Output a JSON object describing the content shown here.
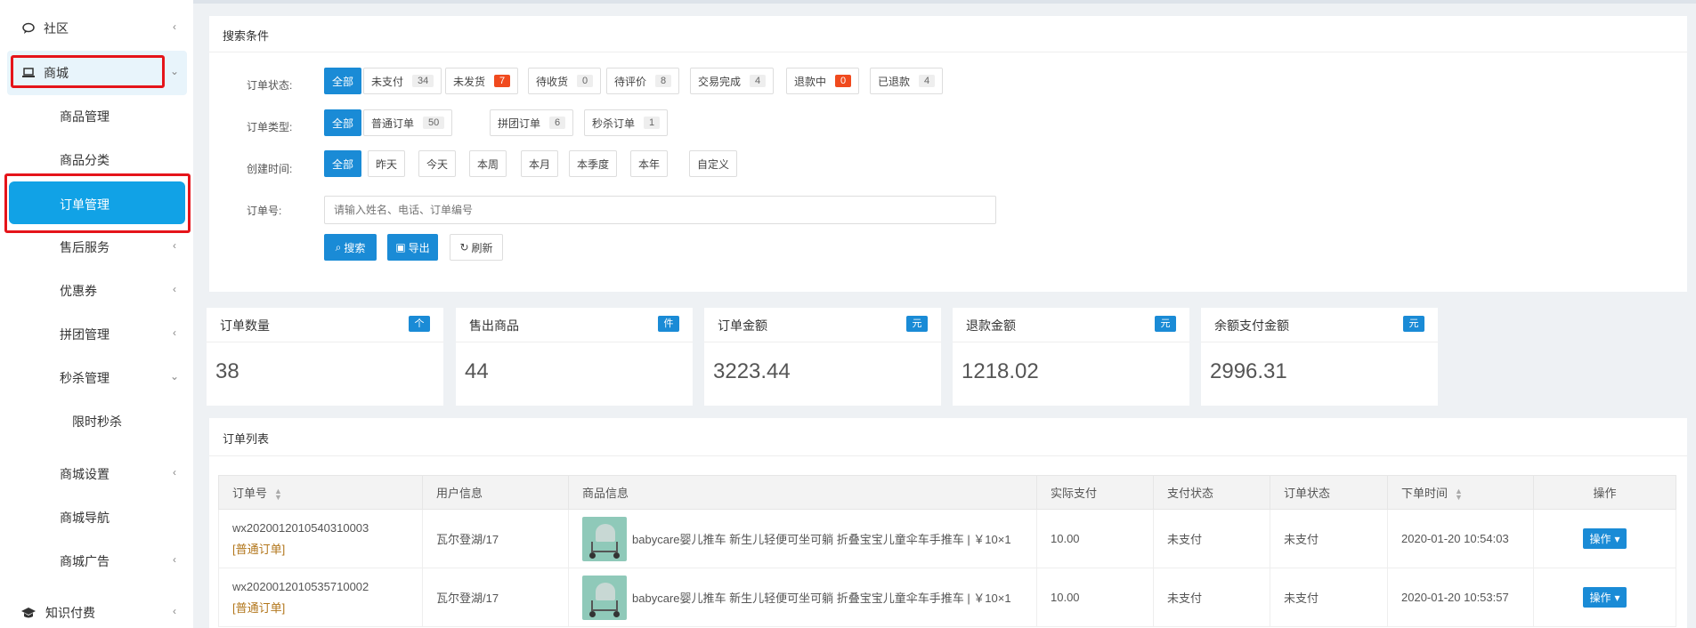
{
  "sidebar": {
    "items": [
      {
        "label": "社区",
        "icon": "chat-icon"
      },
      {
        "label": "商城",
        "icon": "laptop-icon"
      },
      {
        "label": "商品管理"
      },
      {
        "label": "商品分类"
      },
      {
        "label": "订单管理"
      },
      {
        "label": "售后服务"
      },
      {
        "label": "优惠券"
      },
      {
        "label": "拼团管理"
      },
      {
        "label": "秒杀管理"
      },
      {
        "label": "限时秒杀"
      },
      {
        "label": "商城设置"
      },
      {
        "label": "商城导航"
      },
      {
        "label": "商城广告"
      },
      {
        "label": "知识付费",
        "icon": "graduation-cap-icon"
      }
    ]
  },
  "search": {
    "title": "搜索条件",
    "status_label": "订单状态:",
    "type_label": "订单类型:",
    "time_label": "创建时间:",
    "order_no_label": "订单号:",
    "placeholder": "请输入姓名、电话、订单编号",
    "status_filters": [
      {
        "label": "全部"
      },
      {
        "label": "未支付",
        "count": "34"
      },
      {
        "label": "未发货",
        "count": "7"
      },
      {
        "label": "待收货",
        "count": "0"
      },
      {
        "label": "待评价",
        "count": "8"
      },
      {
        "label": "交易完成",
        "count": "4"
      },
      {
        "label": "退款中",
        "count": "0"
      },
      {
        "label": "已退款",
        "count": "4"
      }
    ],
    "type_filters": [
      {
        "label": "全部"
      },
      {
        "label": "普通订单",
        "count": "50"
      },
      {
        "label": "拼团订单",
        "count": "6"
      },
      {
        "label": "秒杀订单",
        "count": "1"
      }
    ],
    "time_filters": [
      {
        "label": "全部"
      },
      {
        "label": "昨天"
      },
      {
        "label": "今天"
      },
      {
        "label": "本周"
      },
      {
        "label": "本月"
      },
      {
        "label": "本季度"
      },
      {
        "label": "本年"
      },
      {
        "label": "自定义"
      }
    ],
    "buttons": {
      "search": "搜索",
      "export": "导出",
      "refresh": "刷新"
    }
  },
  "stats": [
    {
      "title": "订单数量",
      "unit": "个",
      "value": "38"
    },
    {
      "title": "售出商品",
      "unit": "件",
      "value": "44"
    },
    {
      "title": "订单金额",
      "unit": "元",
      "value": "3223.44"
    },
    {
      "title": "退款金额",
      "unit": "元",
      "value": "1218.02"
    },
    {
      "title": "余额支付金额",
      "unit": "元",
      "value": "2996.31"
    }
  ],
  "order_list": {
    "title": "订单列表",
    "columns": [
      "订单号",
      "用户信息",
      "商品信息",
      "实际支付",
      "支付状态",
      "订单状态",
      "下单时间",
      "操作"
    ],
    "rows": [
      {
        "order_no": "wx2020012010540310003",
        "tag": "[普通订单]",
        "user": "瓦尔登湖/17",
        "product": "babycare婴儿推车 新生儿轻便可坐可躺 折叠宝宝儿童伞车手推车 | ￥10×1",
        "paid": "10.00",
        "pay_status": "未支付",
        "order_status": "未支付",
        "time": "2020-01-20 10:54:03",
        "action": "操作"
      },
      {
        "order_no": "wx2020012010535710002",
        "tag": "[普通订单]",
        "user": "瓦尔登湖/17",
        "product": "babycare婴儿推车 新生儿轻便可坐可躺 折叠宝宝儿童伞车手推车 | ￥10×1",
        "paid": "10.00",
        "pay_status": "未支付",
        "order_status": "未支付",
        "time": "2020-01-20 10:53:57",
        "action": "操作"
      }
    ]
  }
}
